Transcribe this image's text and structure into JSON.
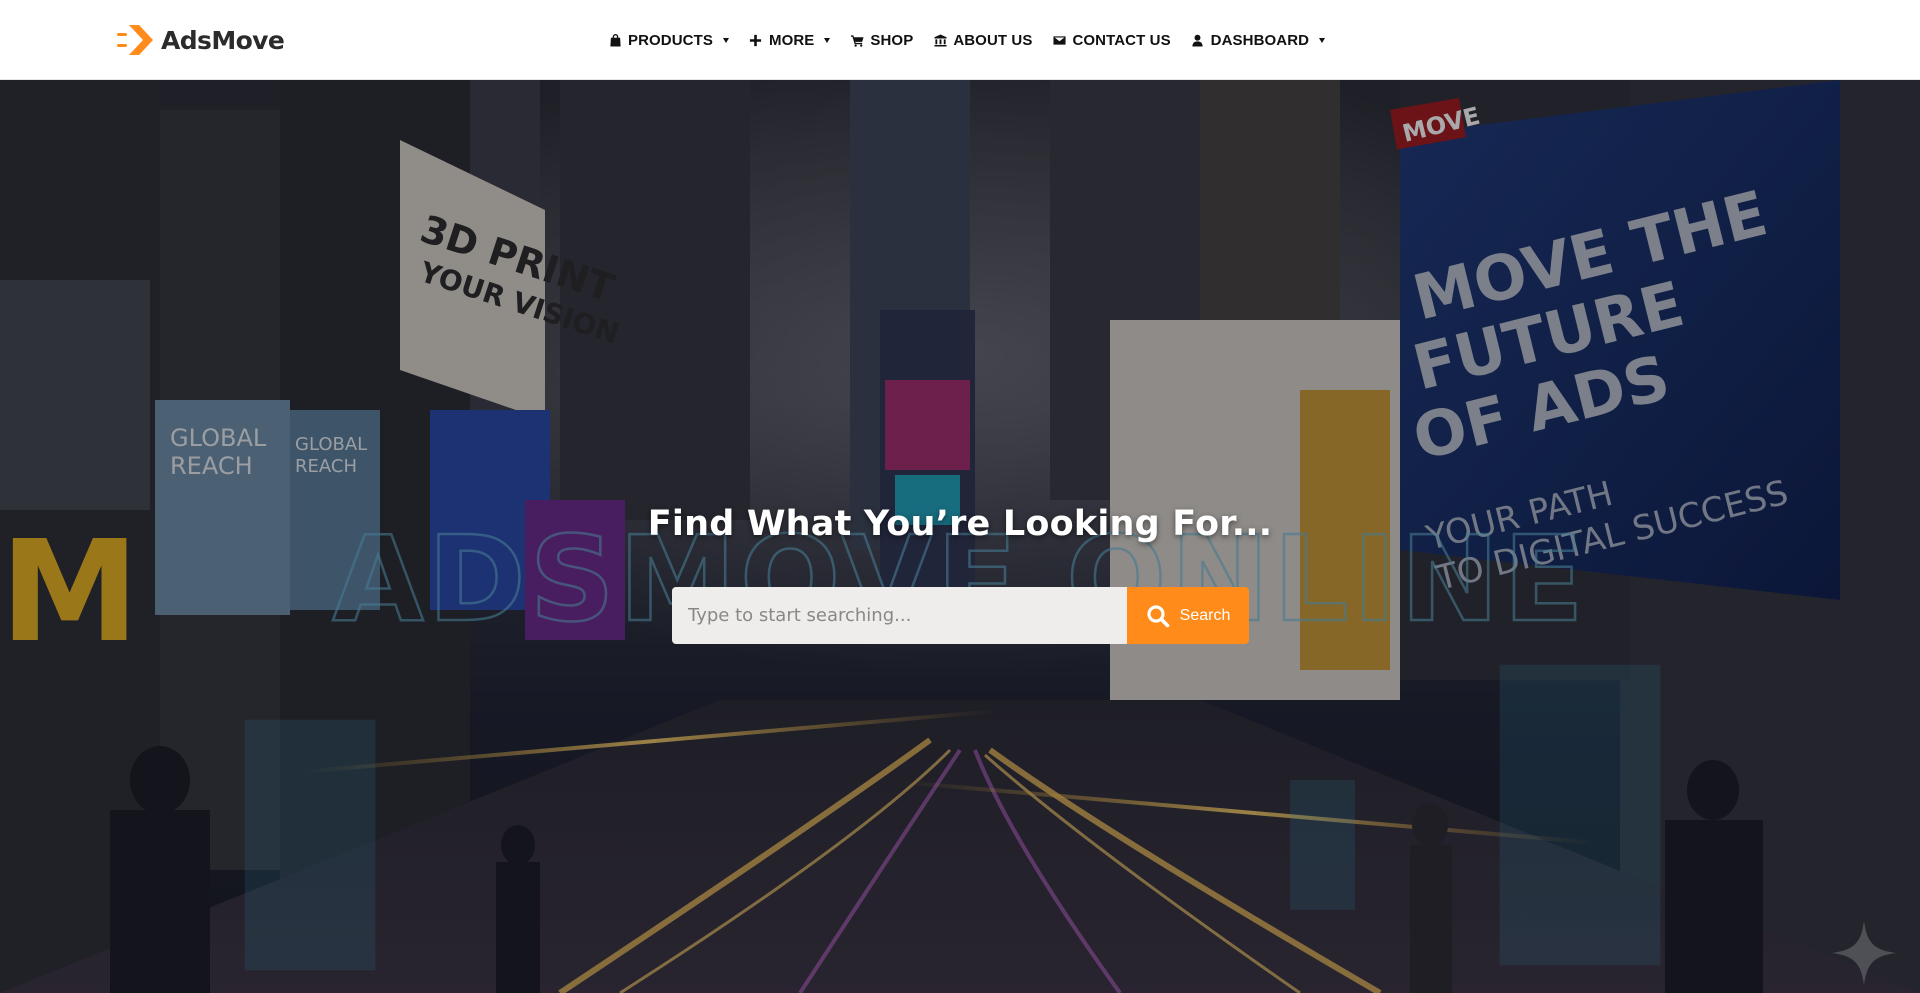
{
  "brand": {
    "name": "AdsMove",
    "accent_color": "#ff8c1a"
  },
  "nav": {
    "items": [
      {
        "label": "PRODUCTS",
        "icon": "bag-icon",
        "has_dropdown": true
      },
      {
        "label": "MORE",
        "icon": "plus-icon",
        "has_dropdown": true
      },
      {
        "label": "SHOP",
        "icon": "cart-icon",
        "has_dropdown": false
      },
      {
        "label": "ABOUT US",
        "icon": "building-icon",
        "has_dropdown": false
      },
      {
        "label": "CONTACT US",
        "icon": "envelope-icon",
        "has_dropdown": false
      },
      {
        "label": "DASHBOARD",
        "icon": "user-icon",
        "has_dropdown": true
      }
    ]
  },
  "hero": {
    "heading": "Find What You’re Looking For...",
    "search": {
      "placeholder": "Type to start searching...",
      "button_label": "Search",
      "button_icon": "search-icon"
    },
    "background_text": {
      "neon_sign": "ADSMOVE ONLINE",
      "billboard_right": "MOVE THE FUTURE OF ADS",
      "billboard_right_sub": "YOUR PATH TO DIGITAL SUCCESS",
      "billboard_left": "3D PRINT YOUR VISION",
      "billboard_small": "GLOBAL REACH",
      "billboard_top": "MOVE"
    }
  },
  "colors": {
    "header_bg": "#ffffff",
    "search_input_bg": "#efedeb",
    "search_button_bg": "#ff8c1a"
  }
}
